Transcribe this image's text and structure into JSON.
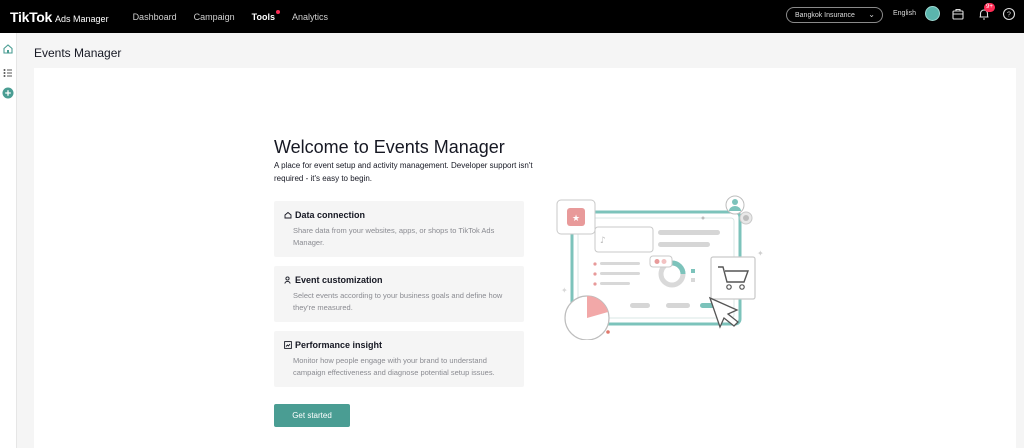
{
  "topbar": {
    "logo_main": "TikTok",
    "logo_sub": "Ads Manager",
    "nav": [
      {
        "label": "Dashboard"
      },
      {
        "label": "Campaign"
      },
      {
        "label": "Tools"
      },
      {
        "label": "Analytics"
      }
    ],
    "account_name": "Bangkok Insurance",
    "language": "English",
    "notification_badge": "9+",
    "icons": [
      "briefcase-icon",
      "bell-icon",
      "help-icon"
    ]
  },
  "sidebar": {
    "icons": [
      "home-icon",
      "list-icon",
      "add-icon"
    ]
  },
  "page": {
    "title": "Events Manager"
  },
  "welcome": {
    "heading": "Welcome to Events Manager",
    "description": "A place for event setup and activity management. Developer support isn't required - it's easy to begin.",
    "features": [
      {
        "title": "Data connection",
        "icon": "connection-icon",
        "description": "Share data from your websites, apps, or shops to TikTok Ads Manager."
      },
      {
        "title": "Event customization",
        "icon": "user-settings-icon",
        "description": "Select events according to your business goals and define how they're measured."
      },
      {
        "title": "Performance insight",
        "icon": "chart-icon",
        "description": "Monitor how people engage with your brand to understand campaign effectiveness and diagnose potential setup issues."
      }
    ],
    "cta_label": "Get started"
  },
  "colors": {
    "accent": "#4a9d93",
    "brand_red": "#fe2c55",
    "topbar_bg": "#000000"
  }
}
